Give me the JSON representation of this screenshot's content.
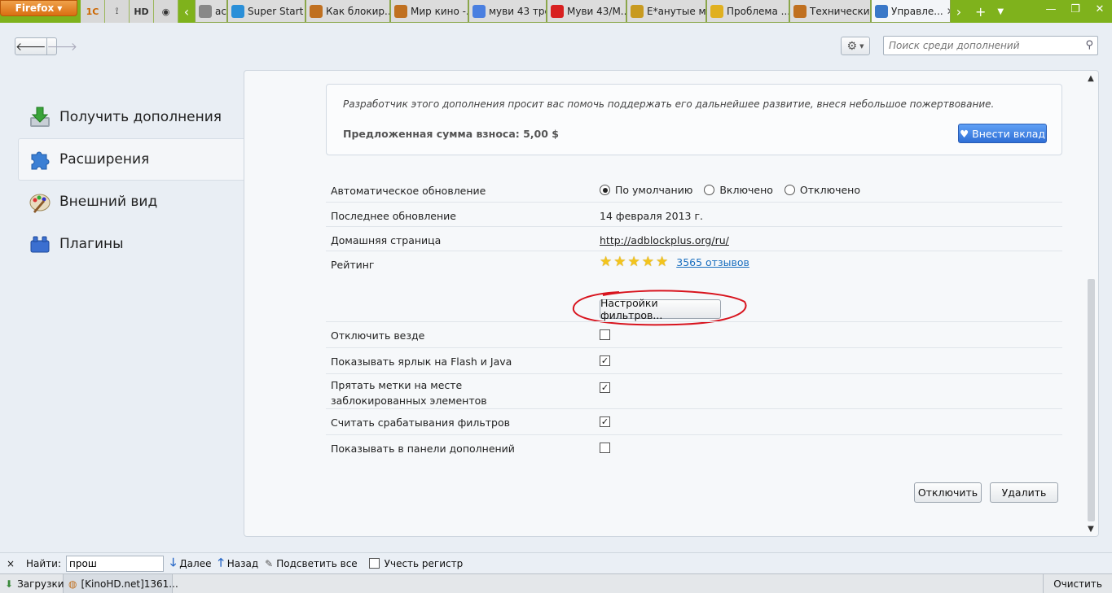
{
  "browser": {
    "menu_label": "Firefox",
    "app_tabs": [
      {
        "icon": "1c-icon",
        "label": "1С"
      },
      {
        "icon": "pin-icon",
        "label": "⟟"
      },
      {
        "icon": "hd-icon",
        "label": "HD"
      },
      {
        "icon": "disc-icon",
        "label": "◉"
      }
    ],
    "tabs": [
      {
        "title": "ac...",
        "icon": "page-icon",
        "color": "#888888"
      },
      {
        "title": "Super Start",
        "icon": "superstart-icon",
        "color": "#2a8fd8"
      },
      {
        "title": "Как блокир...",
        "icon": "kinohd-icon",
        "color": "#c07020"
      },
      {
        "title": "Мир кино -...",
        "icon": "kinohd-icon",
        "color": "#c07020"
      },
      {
        "title": "муви 43 тре...",
        "icon": "google-icon",
        "color": "#4a7fe0"
      },
      {
        "title": "Муви 43/М...",
        "icon": "youtube-icon",
        "color": "#d82020"
      },
      {
        "title": "Е*анутые м...",
        "icon": "smiley-icon",
        "color": "#c89a20"
      },
      {
        "title": "Проблема ...",
        "icon": "warning-icon",
        "color": "#e0b020"
      },
      {
        "title": "Технически...",
        "icon": "kinohd-icon",
        "color": "#c07020"
      },
      {
        "title": "Управле...",
        "icon": "puzzle-icon",
        "color": "#3a78c8",
        "active": true
      }
    ]
  },
  "toolbar": {
    "search_placeholder": "Поиск среди дополнений"
  },
  "sidebar": {
    "items": [
      {
        "label": "Получить дополнения",
        "icon": "get-addons-icon"
      },
      {
        "label": "Расширения",
        "icon": "extensions-icon",
        "selected": true
      },
      {
        "label": "Внешний вид",
        "icon": "appearance-icon"
      },
      {
        "label": "Плагины",
        "icon": "plugins-icon"
      }
    ]
  },
  "contribution": {
    "message": "Разработчик этого дополнения просит вас помочь поддержать его дальнейшее развитие, внеся небольшое пожертвование.",
    "amount_label": "Предложенная сумма взноса: 5,00 $",
    "donate_label": "Внести вклад"
  },
  "details": {
    "auto_update": {
      "label": "Автоматическое обновление",
      "options": [
        {
          "label": "По умолчанию",
          "selected": true
        },
        {
          "label": "Включено",
          "selected": false
        },
        {
          "label": "Отключено",
          "selected": false
        }
      ]
    },
    "last_updated": {
      "label": "Последнее обновление",
      "value": "14 февраля 2013 г."
    },
    "homepage": {
      "label": "Домашняя страница",
      "value": "http://adblockplus.org/ru/"
    },
    "rating": {
      "label": "Рейтинг",
      "stars": 5,
      "reviews": "3565 отзывов"
    }
  },
  "filters_button": "Настройки фильтров...",
  "options": [
    {
      "label": "Отключить везде",
      "checked": false
    },
    {
      "label": "Показывать ярлык на Flash и Java",
      "checked": true
    },
    {
      "label": "Прятать метки на месте заблокированных элементов",
      "checked": true
    },
    {
      "label": "Считать срабатывания фильтров",
      "checked": true
    },
    {
      "label": "Показывать в панели дополнений",
      "checked": false
    }
  ],
  "actions": {
    "disable": "Отключить",
    "remove": "Удалить"
  },
  "findbar": {
    "close": "×",
    "find_label": "Найти:",
    "query": "прош",
    "next": "Далее",
    "previous": "Назад",
    "highlight": "Подсветить все",
    "match_case": "Учесть регистр"
  },
  "statusbar": {
    "downloads": "Загрузки",
    "task": "[KinoHD.net]1361...",
    "clear": "Очистить"
  },
  "colors": {
    "tabbar": "#7fb21c",
    "firefox_button": "#e07a1a",
    "donate": "#3a7be0",
    "annotation_circle": "#d8141e",
    "link": "#1a6fbf"
  }
}
